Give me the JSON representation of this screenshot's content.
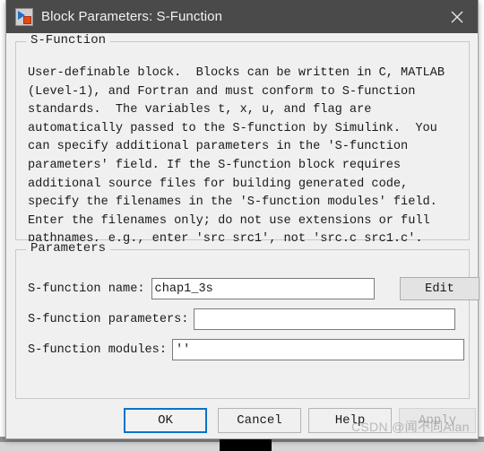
{
  "window": {
    "title": "Block Parameters: S-Function",
    "icon": "simulink-block-icon",
    "close_icon": "close-icon",
    "titlebar_color": "#4a4a4a",
    "body_color": "#f0f0f0"
  },
  "description_group": {
    "legend": "S-Function",
    "text": "User-definable block.  Blocks can be written in C, MATLAB\n(Level-1), and Fortran and must conform to S-function\nstandards.  The variables t, x, u, and flag are\nautomatically passed to the S-function by Simulink.  You\ncan specify additional parameters in the 'S-function\nparameters' field. If the S-function block requires\nadditional source files for building generated code,\nspecify the filenames in the 'S-function modules' field.\nEnter the filenames only; do not use extensions or full\npathnames, e.g., enter 'src src1', not 'src.c src1.c'."
  },
  "parameters_group": {
    "legend": "Parameters",
    "fields": [
      {
        "label": "S-function name:",
        "value": "chap1_3s",
        "placeholder": ""
      },
      {
        "label": "S-function parameters:",
        "value": "",
        "placeholder": ""
      },
      {
        "label": "S-function modules:",
        "value": "''",
        "placeholder": ""
      }
    ],
    "edit_button": "Edit"
  },
  "footer": {
    "ok": "OK",
    "cancel": "Cancel",
    "help": "Help",
    "apply": "Apply",
    "apply_enabled": false,
    "focus_color": "#0a72c8"
  },
  "watermark": {
    "text": "CSDN @闻不同Alan"
  }
}
